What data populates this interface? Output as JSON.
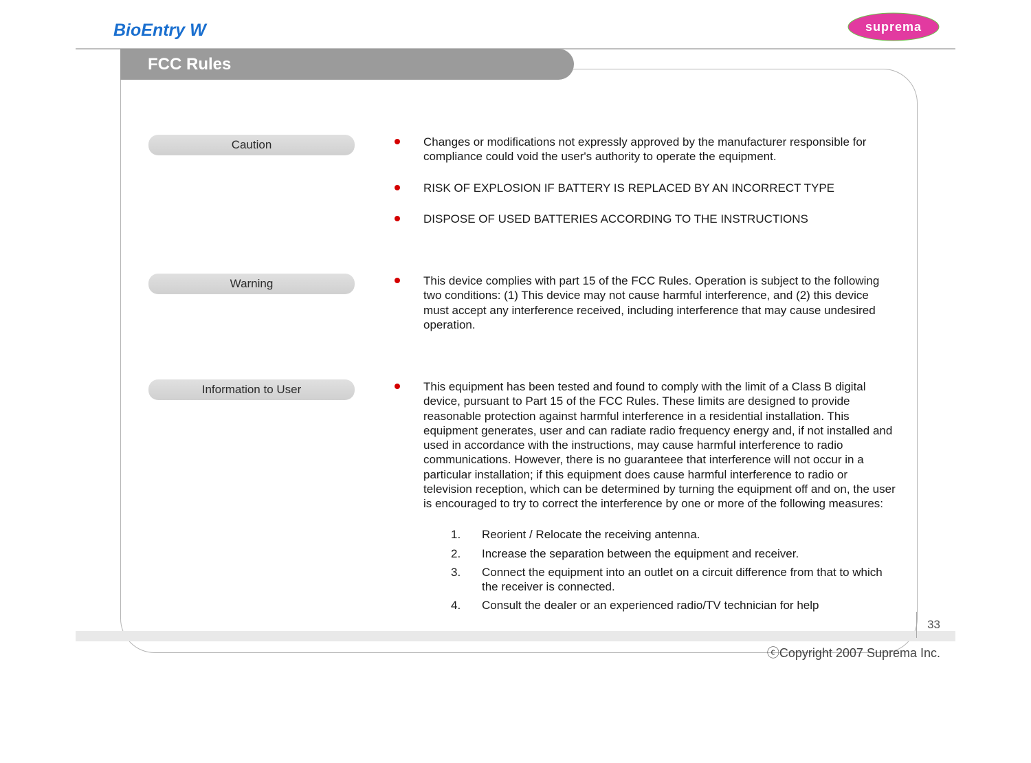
{
  "header": {
    "title": "BioEntry W",
    "logo_text": "suprema"
  },
  "section_title": "FCC Rules",
  "labels": {
    "caution": "Caution",
    "warning": "Warning",
    "info": "Information to User"
  },
  "caution_bullets": [
    "Changes or modifications not expressly approved by the manufacturer responsible for compliance could void the user's authority to operate the equipment.",
    "RISK OF EXPLOSION IF BATTERY IS REPLACED BY AN INCORRECT TYPE",
    "DISPOSE OF USED BATTERIES ACCORDING TO THE INSTRUCTIONS"
  ],
  "warning_bullets": [
    "This device complies with part 15 of the FCC Rules. Operation is subject to the following two conditions: (1) This device may not cause harmful interference, and (2) this device must accept any interference received, including interference that may cause undesired operation."
  ],
  "info_bullets": [
    "This equipment has been tested and found to comply with the limit of a Class B digital device, pursuant to Part 15 of the FCC Rules. These limits are designed to provide reasonable protection against harmful interference in a residential installation. This equipment generates, user and can radiate radio frequency energy and, if not installed and used in accordance with the instructions, may cause harmful interference to radio communications. However, there is no guaranteee that interference will not occur in a particular installation; if this equipment does cause harmful interference to radio or television reception, which can be determined by turning the equipment off and on, the user is encouraged to try to correct the interference by one or more of the following measures:"
  ],
  "info_steps": [
    "Reorient / Relocate the receiving antenna.",
    "Increase the separation between the equipment and receiver.",
    "Connect the equipment into an outlet on a circuit difference from that to which the receiver is connected.",
    "Consult the dealer or an experienced radio/TV technician for help"
  ],
  "footer": {
    "page_number": "33",
    "copyright": "ⓒCopyright 2007 Suprema Inc."
  }
}
